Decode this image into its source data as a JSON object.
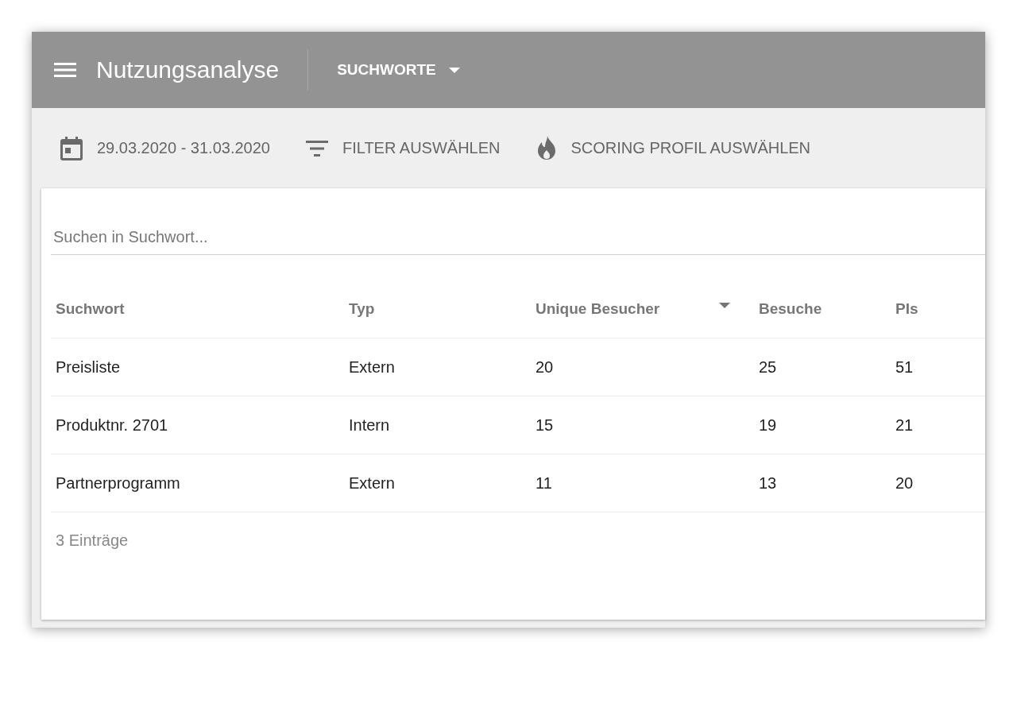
{
  "app_bar": {
    "title": "Nutzungsanalyse",
    "view_selector": "SUCHWORTE"
  },
  "toolbar": [
    {
      "kind": "date",
      "label": "29.03.2020 - 31.03.2020"
    },
    {
      "kind": "filter",
      "label": "FILTER AUSWÄHLEN"
    },
    {
      "kind": "scoring",
      "label": "SCORING PROFIL AUSWÄHLEN"
    }
  ],
  "search": {
    "placeholder": "Suchen in Suchwort..."
  },
  "table": {
    "columns": [
      {
        "label": "Suchwort",
        "sorted": false
      },
      {
        "label": "Typ",
        "sorted": false
      },
      {
        "label": "Unique Besucher",
        "sorted": true
      },
      {
        "label": "Besuche",
        "sorted": false
      },
      {
        "label": "PIs",
        "sorted": false
      }
    ],
    "rows": [
      [
        "Preisliste",
        "Extern",
        "20",
        "25",
        "51"
      ],
      [
        "Produktnr. 2701",
        "Intern",
        "15",
        "19",
        "21"
      ],
      [
        "Partnerprogramm",
        "Extern",
        "11",
        "13",
        "20"
      ]
    ]
  },
  "footer": "3 Einträge"
}
